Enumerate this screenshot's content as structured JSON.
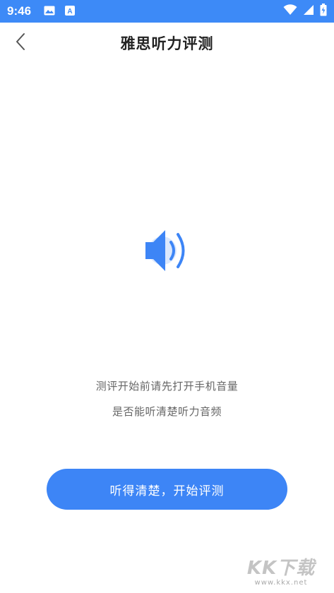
{
  "status_bar": {
    "time": "9:46",
    "left_icons": [
      "image-icon",
      "text-a-icon"
    ],
    "right_icons": [
      "wifi-icon",
      "signal-icon",
      "battery-icon"
    ],
    "background": "#3d8af7"
  },
  "header": {
    "title": "雅思听力评测",
    "back_icon": "chevron-left-icon"
  },
  "main": {
    "speaker_icon": "speaker-volume-icon",
    "accent": "#3d85f6",
    "hint_line_1": "测评开始前请先打开手机音量",
    "hint_line_2": "是否能听清楚听力音频"
  },
  "actions": {
    "start_label": "听得清楚，开始评测"
  },
  "watermark": {
    "logo": "KK下载",
    "url": "www.kkx.net"
  }
}
